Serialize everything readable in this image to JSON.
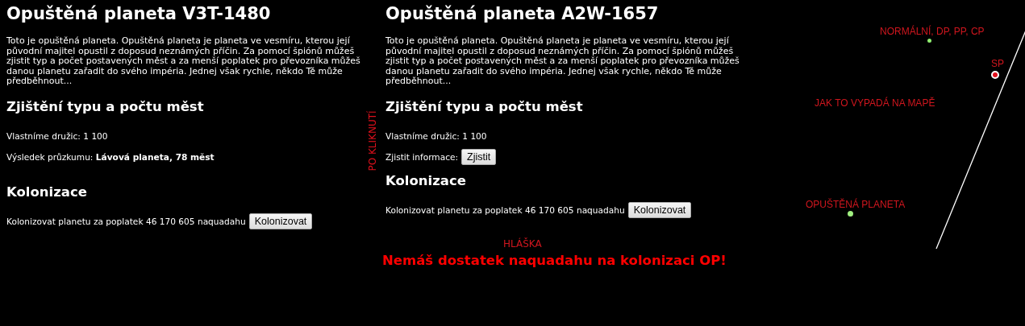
{
  "panels": [
    {
      "title": "Opuštěná planeta V3T-1480",
      "description": "Toto je opuštěná planeta. Opuštěná planeta je planeta ve vesmíru, kterou její původní majitel opustil z doposud neznámých příčin. Za pomocí špiónů můžeš zjistit typ a počet postavených měst a za menší poplatek pro převozníka můžeš danou planetu zařadit do svého impéria. Jednej však rychle, někdo Tě může předběhnout...",
      "survey_heading": "Zjištění typu a počtu měst",
      "satellites": "Vlastníme družic: 1 100",
      "survey": {
        "kind": "result",
        "label": "Výsledek průzkumu:",
        "value": "Lávová planeta, 78 měst"
      },
      "colonize_heading": "Kolonizace",
      "colonize_text": "Kolonizovat planetu za poplatek 46 170 605 naquadahu",
      "colonize_button": "Kolonizovat",
      "side_note": "PO KLIKNUTÍ"
    },
    {
      "title": "Opuštěná planeta A2W-1657",
      "description": "Toto je opuštěná planeta. Opuštěná planeta je planeta ve vesmíru, kterou její původní majitel opustil z doposud neznámých příčin. Za pomocí špiónů můžeš zjistit typ a počet postavených měst a za menší poplatek pro převozníka můžeš danou planetu zařadit do svého impéria. Jednej však rychle, někdo Tě může předběhnout...",
      "survey_heading": "Zjištění typu a počtu měst",
      "satellites": "Vlastníme družic: 1 100",
      "survey": {
        "kind": "button",
        "label": "Zjistit informace:",
        "value": "Zjistit"
      },
      "colonize_heading": "Kolonizace",
      "colonize_text": "Kolonizovat planetu za poplatek 46 170 605 naquadahu",
      "colonize_button": "Kolonizovat",
      "message_note": "HLÁŠKA",
      "message": "Nemáš dostatek naquadahu na kolonizaci OP!"
    }
  ],
  "map": {
    "title": "JAK TO VYPADÁ NA MAPĚ",
    "markers": [
      {
        "kind": "small",
        "label": "NORMÁLNÍ, DP, PP, CP",
        "color": "#90ee70"
      },
      {
        "kind": "sun",
        "label": "SP",
        "color": "#e0101c"
      },
      {
        "kind": "planet",
        "label": "OPUŠTĚNÁ PLANETA",
        "color": "#a0f080"
      }
    ]
  }
}
